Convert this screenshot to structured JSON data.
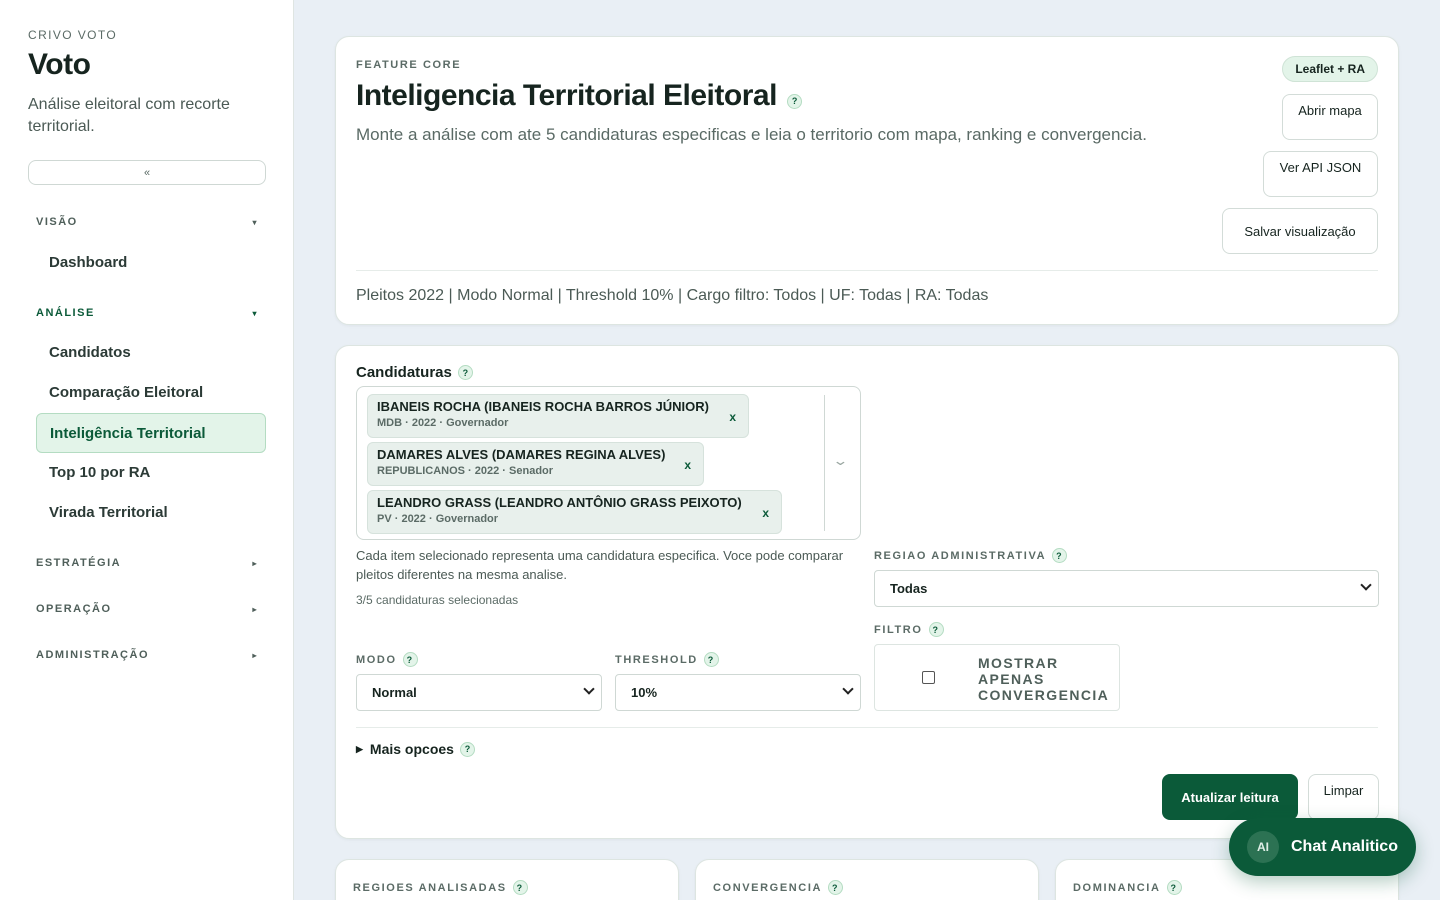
{
  "sidebar": {
    "kicker": "CRIVO VOTO",
    "title": "Voto",
    "subtitle": "Análise eleitoral com recorte territorial.",
    "collapse_label": "«",
    "groups": {
      "visao": {
        "label": "VISÃO",
        "caret": "▾"
      },
      "analise": {
        "label": "ANÁLISE",
        "caret": "▾"
      },
      "estrategia": {
        "label": "ESTRATÉGIA",
        "caret": "▸"
      },
      "operacao": {
        "label": "OPERAÇÃO",
        "caret": "▸"
      },
      "administracao": {
        "label": "ADMINISTRAÇÃO",
        "caret": "▸"
      }
    },
    "items": {
      "dashboard": "Dashboard",
      "candidatos": "Candidatos",
      "comparacao": "Comparação Eleitoral",
      "inteligencia": "Inteligência Territorial",
      "top10": "Top 10 por RA",
      "virada": "Virada Territorial"
    },
    "active_item": "Inteligência Territorial"
  },
  "hero": {
    "kicker": "FEATURE CORE",
    "title": "Inteligencia Territorial Eleitoral",
    "help": "?",
    "description": "Monte a análise com ate 5 candidaturas especificas e leia o territorio com mapa, ranking e convergencia.",
    "badge": "Leaflet + RA",
    "buttons": {
      "open_map": "Abrir mapa",
      "api_json": "Ver API JSON",
      "save_view": "Salvar visualização"
    },
    "summary": "Pleitos 2022 | Modo Normal | Threshold 10% | Cargo filtro: Todos | UF: Todas | RA: Todas"
  },
  "form": {
    "candidaturas_label": "Candidaturas",
    "help": "?",
    "chips": [
      {
        "name": "IBANEIS ROCHA (IBANEIS ROCHA BARROS JÚNIOR)",
        "meta": "MDB · 2022 · Governador",
        "remove": "x"
      },
      {
        "name": "DAMARES ALVES (DAMARES REGINA ALVES)",
        "meta": "REPUBLICANOS · 2022 · Senador",
        "remove": "x"
      },
      {
        "name": "LEANDRO GRASS (LEANDRO ANTÔNIO GRASS PEIXOTO)",
        "meta": "PV · 2022 · Governador",
        "remove": "x"
      }
    ],
    "dropdown_chevron": "⌄",
    "hint": "Cada item selecionado representa uma candidatura especifica. Voce pode comparar pleitos diferentes na mesma analise.",
    "count": "3/5 candidaturas selecionadas",
    "regiao": {
      "label": "REGIAO ADMINISTRATIVA",
      "value": "Todas"
    },
    "filtro": {
      "label": "FILTRO",
      "option": "MOSTRAR APENAS CONVERGENCIA",
      "checked": false
    },
    "modo": {
      "label": "MODO",
      "value": "Normal"
    },
    "threshold": {
      "label": "THRESHOLD",
      "value": "10%"
    },
    "more_options": "Mais opcoes",
    "more_marker": "▶",
    "submit": "Atualizar leitura",
    "clear": "Limpar"
  },
  "stats": {
    "regioes": "REGIOES ANALISADAS",
    "convergencia": "CONVERGENCIA",
    "dominancia": "DOMINANCIA"
  },
  "chat": {
    "avatar": "AI",
    "label": "Chat Analitico"
  },
  "colors": {
    "accent": "#0b5a39",
    "accent_light": "#e3f4e9",
    "background": "#e9eff5"
  }
}
